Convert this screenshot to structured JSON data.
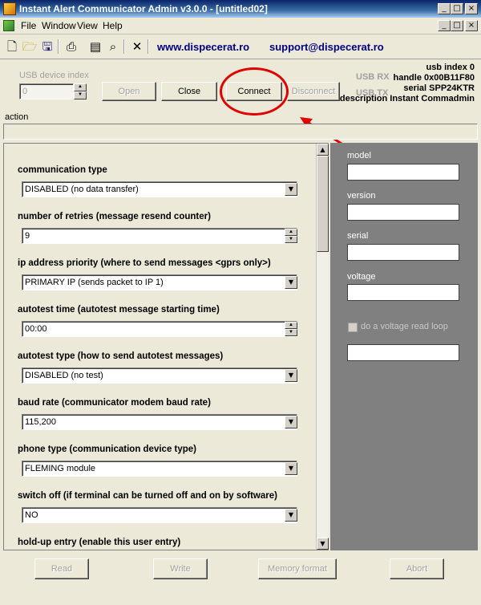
{
  "window": {
    "title": "Instant Alert Communicator Admin v3.0.0 - [untitled02]",
    "controls": {
      "minimize": "_",
      "maximize": "□",
      "close": "×"
    }
  },
  "menu": {
    "items": [
      "File",
      "Window",
      "View",
      "Help"
    ]
  },
  "toolbar": {
    "icons": [
      "new-icon",
      "open-icon",
      "save-icon",
      "print-icon",
      "properties-icon",
      "zoom-icon",
      "close-doc-icon"
    ],
    "website": "www.dispecerat.ro",
    "support": "support@dispecerat.ro"
  },
  "usb": {
    "device_index_label": "USB device index",
    "device_index_value": "0",
    "rx_label": "USB RX",
    "tx_label": "USB TX",
    "buttons": {
      "open": "Open",
      "close": "Close",
      "connect": "Connect",
      "disconnect": "Disconnect"
    },
    "info": {
      "usb_index": "usb index 0",
      "handle": "handle 0x00B11F80",
      "serial": "serial SPP24KTR",
      "description": "description Instant Commadmin"
    }
  },
  "action_label": "action",
  "settings": [
    {
      "label": "communication type",
      "kind": "dropdown",
      "value": "DISABLED (no data transfer)"
    },
    {
      "label": "number of retries (message resend counter)",
      "kind": "spinner",
      "value": "9"
    },
    {
      "label": "ip address priority (where to send messages <gprs only>)",
      "kind": "dropdown",
      "value": "PRIMARY IP (sends packet to IP 1)"
    },
    {
      "label": "autotest time (autotest message starting time)",
      "kind": "spinner",
      "value": "00:00"
    },
    {
      "label": "autotest type (how to send autotest messages)",
      "kind": "dropdown",
      "value": "DISABLED (no test)"
    },
    {
      "label": "baud rate (communicator modem baud rate)",
      "kind": "dropdown",
      "value": "115,200"
    },
    {
      "label": "phone type (communication device type)",
      "kind": "dropdown",
      "value": "FLEMING module"
    },
    {
      "label": "switch off (if terminal can be turned off and on by software)",
      "kind": "dropdown",
      "value": "NO"
    },
    {
      "label": "hold-up entry (enable this user entry)",
      "kind": "none",
      "value": ""
    }
  ],
  "device_panel": {
    "model_label": "model",
    "version_label": "version",
    "serial_label": "serial",
    "voltage_label": "voltage",
    "voltage_loop_label": "do a voltage read loop",
    "voltage_loop_checked": false
  },
  "bottom_buttons": {
    "read": "Read",
    "write": "Write",
    "memory_format": "Memory format",
    "abort": "Abort"
  },
  "colors": {
    "title_bar": "#0a246a",
    "link": "#000080",
    "annotation": "#e00000",
    "device_panel": "#808080"
  }
}
